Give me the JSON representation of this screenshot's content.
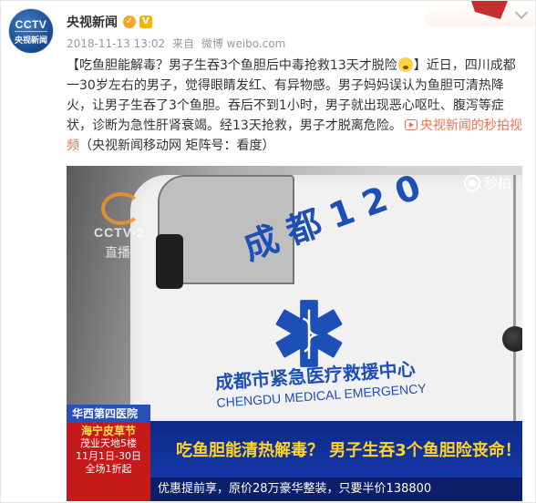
{
  "header": {
    "account_name": "央视新闻",
    "verified_icon": "verified-badge-icon",
    "vip_icon": "vip-badge-icon",
    "timestamp": "2018-11-13 13:02",
    "source_prefix": "来自",
    "source": "微博 weibo.com",
    "avatar": {
      "logo_top": "CCTV",
      "logo_bottom": "央视新闻"
    }
  },
  "post": {
    "headline": "【吃鱼胆能解毒？男子生吞3个鱼胆后中毒抢救13天才脱险",
    "headline_end": "】",
    "emoji": "surprised-face-icon",
    "body": "近日，四川成都一30岁左右的男子，觉得眼睛发红、有异物感。男子妈妈误认为鱼胆可清热降火，让男子生吞了3个鱼胆。吞后不到1小时，男子就出现恶心呕吐、腹泻等症状，诊断为急性肝肾衰竭。经13天抢救，男子才脱离危险。",
    "link_label": "央视新闻的秒拍视频",
    "suffix": "（央视新闻移动网 矩阵号：看度）"
  },
  "video": {
    "watermark": "秒拍",
    "tv_logo": {
      "brand": "CCTV-2",
      "live": "直播"
    },
    "van_number": "成都120",
    "van_text_cn": "成都市紧急医疗救援中心",
    "van_text_en": "CHENGDU MEDICAL EMERGENCY",
    "caption_tag": "华西第四医院",
    "caption_main": "吃鱼胆能清热解毒？ 男子生吞3个鱼胆险丧命！",
    "ad_lines": [
      "海宁皮草节",
      "茂业天地5楼",
      "11月1日-30日",
      "全场1折起"
    ],
    "ticker": "优惠提前享，原价28万豪华整装，只要半价138800"
  },
  "colors": {
    "link": "#eb7350",
    "caption_text": "#ffd42a",
    "caption_bg": "#0b2a87",
    "van_blue": "#1d4fb8"
  }
}
